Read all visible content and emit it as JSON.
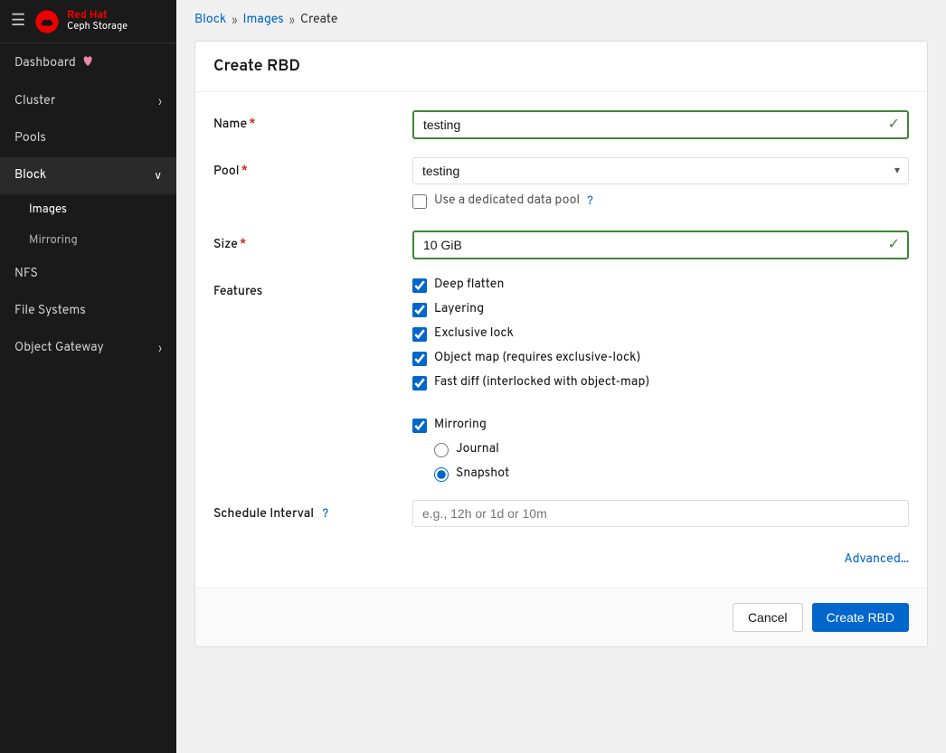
{
  "sidebar": {
    "logo": {
      "brand": "Red Hat",
      "product": "Ceph Storage"
    },
    "items": [
      {
        "id": "dashboard",
        "label": "Dashboard",
        "icon": "heart-icon",
        "hasChildren": false
      },
      {
        "id": "cluster",
        "label": "Cluster",
        "hasChevron": true
      },
      {
        "id": "pools",
        "label": "Pools",
        "hasChevron": false
      },
      {
        "id": "block",
        "label": "Block",
        "hasChevron": true,
        "active": true
      },
      {
        "id": "images",
        "label": "Images",
        "sub": true,
        "active": true
      },
      {
        "id": "mirroring",
        "label": "Mirroring",
        "sub": true
      },
      {
        "id": "nfs",
        "label": "NFS",
        "hasChevron": false
      },
      {
        "id": "filesystems",
        "label": "File Systems",
        "hasChevron": false
      },
      {
        "id": "objectgateway",
        "label": "Object Gateway",
        "hasChevron": true
      }
    ]
  },
  "breadcrumb": {
    "items": [
      "Block",
      "Images",
      "Create"
    ]
  },
  "form": {
    "title": "Create RBD",
    "name": {
      "label": "Name",
      "required": true,
      "value": "testing",
      "valid": true
    },
    "pool": {
      "label": "Pool",
      "required": true,
      "value": "testing",
      "options": [
        "testing"
      ]
    },
    "dedicated_pool": {
      "label": "Use a dedicated data pool",
      "checked": false
    },
    "size": {
      "label": "Size",
      "required": true,
      "value": "10 GiB",
      "valid": true
    },
    "features": {
      "label": "Features",
      "items": [
        {
          "id": "deep_flatten",
          "label": "Deep flatten",
          "checked": true
        },
        {
          "id": "layering",
          "label": "Layering",
          "checked": true
        },
        {
          "id": "exclusive_lock",
          "label": "Exclusive lock",
          "checked": true
        },
        {
          "id": "object_map",
          "label": "Object map (requires exclusive-lock)",
          "checked": true
        },
        {
          "id": "fast_diff",
          "label": "Fast diff (interlocked with object-map)",
          "checked": true
        }
      ]
    },
    "mirroring": {
      "id": "mirroring",
      "label": "Mirroring",
      "checked": true
    },
    "mirror_mode": {
      "options": [
        {
          "id": "journal",
          "label": "Journal",
          "selected": false
        },
        {
          "id": "snapshot",
          "label": "Snapshot",
          "selected": true
        }
      ]
    },
    "schedule_interval": {
      "label": "Schedule Interval",
      "placeholder": "e.g., 12h or 1d or 10m",
      "value": ""
    },
    "advanced_link": "Advanced...",
    "cancel_button": "Cancel",
    "create_button": "Create RBD"
  }
}
